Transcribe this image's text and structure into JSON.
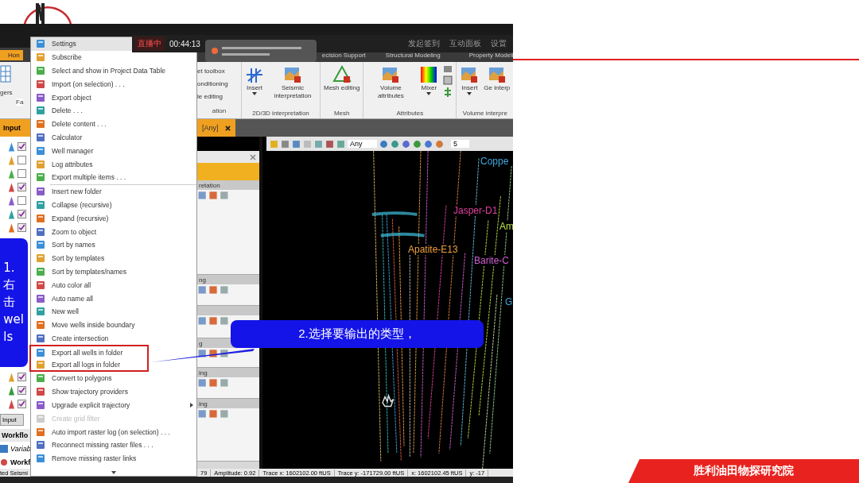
{
  "slide": {
    "footer": "胜利油田物探研究院"
  },
  "broadcast_bar": {
    "live": "直播中",
    "timer": "00:44:13",
    "actions": [
      "发起签到",
      "互动面板",
      "设置"
    ]
  },
  "ribbon_tabs": [
    {
      "label": "Hon",
      "selected": true
    },
    {
      "label": "ecision Support",
      "selected": false
    },
    {
      "label": "Structural Modeling",
      "selected": false
    },
    {
      "label": "Property Modeli",
      "selected": false
    }
  ],
  "ribbon": {
    "left_texts": [
      "gers",
      "Fa"
    ],
    "partial_items": [
      "et toolbox",
      "onditioning",
      "le editing"
    ],
    "partial_group": "ation",
    "groups": [
      {
        "label": "2D/3D interpretation",
        "buttons": [
          {
            "label": "Insert",
            "dropdown": true
          },
          {
            "label": "Seismic interpretation",
            "dropdown": false
          }
        ]
      },
      {
        "label": "Mesh",
        "buttons": [
          {
            "label": "Mesh editing",
            "dropdown": false
          }
        ]
      },
      {
        "label": "Attributes",
        "buttons": [
          {
            "label": "Volume attributes",
            "dropdown": false
          },
          {
            "label": "Mixer",
            "dropdown": true
          }
        ]
      },
      {
        "label": "Volume interpre",
        "buttons": [
          {
            "label": "Insert",
            "dropdown": true
          },
          {
            "label": "Ge interp",
            "dropdown": false
          }
        ]
      }
    ]
  },
  "document_tabs": {
    "left_header": "Input",
    "tab": "[Any]"
  },
  "tree": {
    "rows": [
      {
        "checked": true
      },
      {
        "checked": false
      },
      {
        "checked": false
      },
      {
        "checked": true
      },
      {
        "checked": false
      },
      {
        "checked": true
      },
      {
        "checked": true
      }
    ],
    "rows_lower": [
      {
        "checked": true
      },
      {
        "checked": true
      },
      {
        "checked": true
      }
    ],
    "bottom_tab": "Input",
    "workflow_header": "Workflo",
    "workflow_items": [
      {
        "label": "Variab",
        "kind": "variable"
      },
      {
        "label": "Workf",
        "kind": "workflow"
      }
    ]
  },
  "tool_palette": {
    "sections": [
      {
        "label": "retation"
      },
      {
        "label": "ng"
      },
      {
        "label": "g"
      },
      {
        "label": "ing"
      },
      {
        "label": "ing"
      }
    ]
  },
  "viewport": {
    "filter": "Any",
    "number": "5",
    "well_labels": [
      {
        "text": "Coppe",
        "color": "#3fa9e0"
      },
      {
        "text": "Jasper-D1",
        "color": "#e040a0"
      },
      {
        "text": "Am",
        "color": "#b8e040"
      },
      {
        "text": "Apatite-E13",
        "color": "#f0a040"
      },
      {
        "text": "Barite-C",
        "color": "#d060d0"
      },
      {
        "text": "G",
        "color": "#3fa9e0"
      }
    ]
  },
  "context_menu": {
    "items": [
      {
        "kind": "header",
        "label": "Settings",
        "disabled": false,
        "submenu": false,
        "highlighted": false
      },
      {
        "kind": "item",
        "label": "Subscribe",
        "disabled": false,
        "submenu": false,
        "highlighted": false
      },
      {
        "kind": "item",
        "label": "Select and show in Project Data Table",
        "disabled": false,
        "submenu": false,
        "highlighted": false
      },
      {
        "kind": "item",
        "label": "Import (on selection) . . .",
        "disabled": false,
        "submenu": false,
        "highlighted": false
      },
      {
        "kind": "item",
        "label": "Export object",
        "disabled": false,
        "submenu": false,
        "highlighted": false
      },
      {
        "kind": "item",
        "label": "Delete . . .",
        "disabled": false,
        "submenu": false,
        "highlighted": false
      },
      {
        "kind": "item",
        "label": "Delete content . . .",
        "disabled": false,
        "submenu": false,
        "highlighted": false
      },
      {
        "kind": "item",
        "label": "Calculator",
        "disabled": false,
        "submenu": false,
        "highlighted": false
      },
      {
        "kind": "item",
        "label": "Well manager",
        "disabled": false,
        "submenu": false,
        "highlighted": false
      },
      {
        "kind": "item",
        "label": "Log attributes",
        "disabled": false,
        "submenu": false,
        "highlighted": false
      },
      {
        "kind": "item",
        "label": "Export multiple items . . .",
        "disabled": false,
        "submenu": false,
        "highlighted": false
      },
      {
        "kind": "separator"
      },
      {
        "kind": "item",
        "label": "Insert new folder",
        "disabled": false,
        "submenu": false,
        "highlighted": false
      },
      {
        "kind": "item",
        "label": "Collapse (recursive)",
        "disabled": false,
        "submenu": false,
        "highlighted": false
      },
      {
        "kind": "item",
        "label": "Expand (recursive)",
        "disabled": false,
        "submenu": false,
        "highlighted": false
      },
      {
        "kind": "item",
        "label": "Zoom to object",
        "disabled": false,
        "submenu": false,
        "highlighted": false
      },
      {
        "kind": "item",
        "label": "Sort by names",
        "disabled": false,
        "submenu": false,
        "highlighted": false
      },
      {
        "kind": "item",
        "label": "Sort by templates",
        "disabled": false,
        "submenu": false,
        "highlighted": false
      },
      {
        "kind": "item",
        "label": "Sort by templates/names",
        "disabled": false,
        "submenu": false,
        "highlighted": false
      },
      {
        "kind": "item",
        "label": "Auto color all",
        "disabled": false,
        "submenu": false,
        "highlighted": false
      },
      {
        "kind": "item",
        "label": "Auto name all",
        "disabled": false,
        "submenu": false,
        "highlighted": false
      },
      {
        "kind": "item",
        "label": "New well",
        "disabled": false,
        "submenu": false,
        "highlighted": false
      },
      {
        "kind": "item",
        "label": "Move wells inside boundary",
        "disabled": false,
        "submenu": false,
        "highlighted": false
      },
      {
        "kind": "item",
        "label": "Create intersection",
        "disabled": false,
        "submenu": false,
        "highlighted": false
      },
      {
        "kind": "item",
        "label": "Export all wells in folder",
        "disabled": false,
        "submenu": false,
        "highlighted": true
      },
      {
        "kind": "item",
        "label": "Export all logs in folder",
        "disabled": false,
        "submenu": false,
        "highlighted": true
      },
      {
        "kind": "item",
        "label": "Convert to polygons",
        "disabled": false,
        "submenu": false,
        "highlighted": false
      },
      {
        "kind": "item",
        "label": "Show trajectory providers",
        "disabled": false,
        "submenu": false,
        "highlighted": false
      },
      {
        "kind": "item",
        "label": "Upgrade explicit trajectory",
        "disabled": false,
        "submenu": true,
        "highlighted": false
      },
      {
        "kind": "item",
        "label": "Create grid filter",
        "disabled": true,
        "submenu": false,
        "highlighted": false
      },
      {
        "kind": "item",
        "label": "Auto import raster log (on selection) . . .",
        "disabled": false,
        "submenu": false,
        "highlighted": false
      },
      {
        "kind": "item",
        "label": "Reconnect missing raster files . . .",
        "disabled": false,
        "submenu": false,
        "highlighted": false
      },
      {
        "kind": "item",
        "label": "Remove missing raster links",
        "disabled": false,
        "submenu": false,
        "highlighted": false
      }
    ]
  },
  "status_bar": [
    "ted Seismi",
    "79",
    "Amplitude: 0.92",
    "Trace x: 1602102.00 ftUS",
    "Trace y: -171729.00 ftUS",
    "x: 1602102.45 ftUS",
    "y: -17"
  ],
  "callouts": [
    {
      "text": "1.右击wells"
    },
    {
      "text": "2.选择要输出的类型，"
    }
  ]
}
